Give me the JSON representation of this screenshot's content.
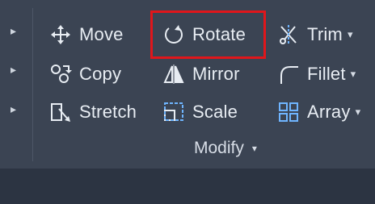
{
  "ribbon": {
    "rows": [
      [
        {
          "label": "Move",
          "icon": "move-icon"
        },
        {
          "label": "Rotate",
          "icon": "rotate-icon"
        },
        {
          "label": "Trim",
          "icon": "trim-icon",
          "dropdown": "▾"
        }
      ],
      [
        {
          "label": "Copy",
          "icon": "copy-icon"
        },
        {
          "label": "Mirror",
          "icon": "mirror-icon"
        },
        {
          "label": "Fillet",
          "icon": "fillet-icon",
          "dropdown": "▾"
        }
      ],
      [
        {
          "label": "Stretch",
          "icon": "stretch-icon"
        },
        {
          "label": "Scale",
          "icon": "scale-icon"
        },
        {
          "label": "Array",
          "icon": "array-icon",
          "dropdown": "▾"
        }
      ]
    ],
    "panel_title": "Modify",
    "panel_dropdown": "▾",
    "left_arrows": [
      "▸",
      "▸",
      "▸"
    ],
    "highlight_color": "#e0161b"
  }
}
